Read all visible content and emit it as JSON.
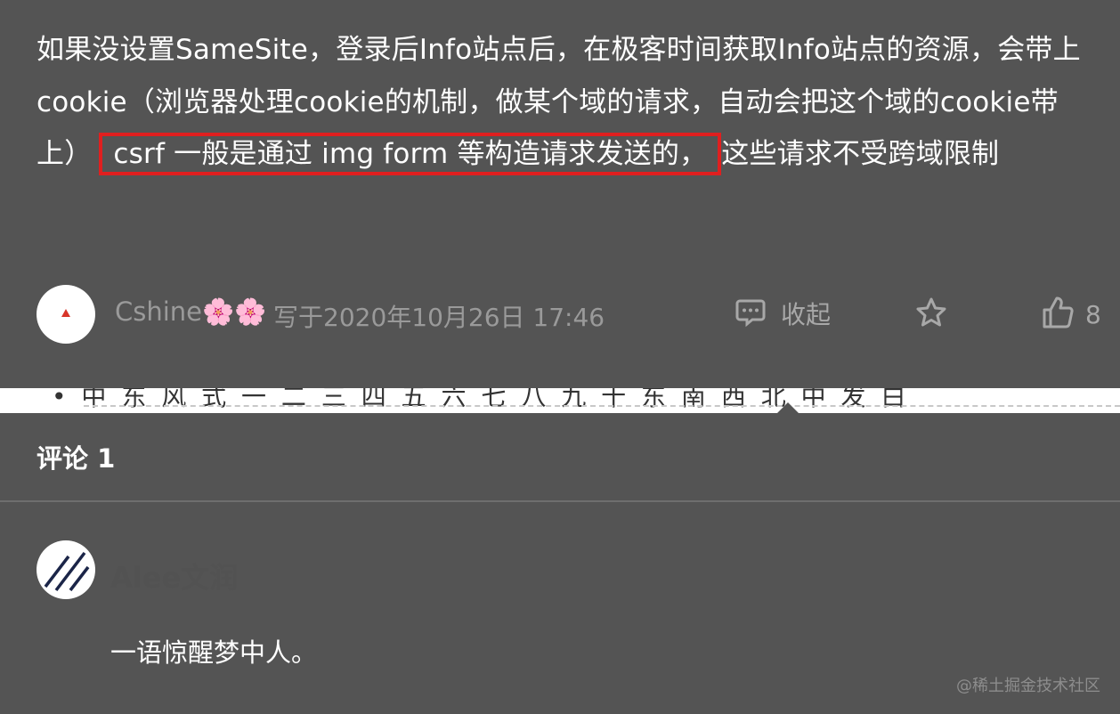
{
  "post": {
    "text_part1": "如果没设置SameSite，登录后Info站点后，在极客时间获取Info站点的资源，会带上cookie（浏览器处理cookie的机制，做某个域的请求，自动会把这个域的cookie带上）",
    "highlight": "csrf 一般是通过 img form 等构造请求发送的，",
    "text_part2": "这些请求不受跨域限制"
  },
  "meta": {
    "author": "Cshine🌸🌸",
    "time": "写于2020年10月26日 17:46",
    "collapse_label": "收起",
    "like_count": "8"
  },
  "strip": {
    "cut_text": "• 中 东 风 式  一 二 三 四 五 六 七 八 九 十 东 南 西 北 中 发 白"
  },
  "comments": {
    "title": "评论 1",
    "items": [
      {
        "name": "Alee文润",
        "text": "一语惊醒梦中人。"
      }
    ]
  },
  "watermark": "@稀土掘金技术社区",
  "colors": {
    "background": "#545454",
    "highlight_border": "#e01f1f",
    "muted_text": "#9a9a9a"
  }
}
